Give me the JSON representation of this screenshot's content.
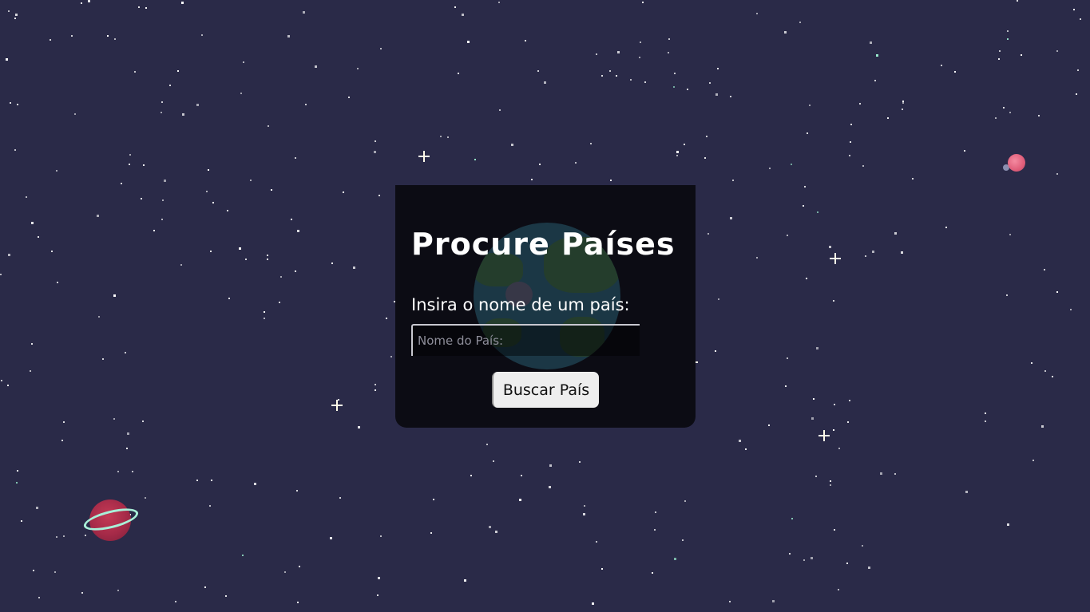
{
  "colors": {
    "background": "#2a2a48",
    "card_background": "#0c0c14",
    "text": "#ffffff",
    "button_background": "#eeeeee",
    "button_text": "#111111",
    "placeholder": "#8e8e9a"
  },
  "card": {
    "title": "Procure Países",
    "field_label": "Insira o nome de um país:",
    "input_value": "",
    "input_placeholder": "Nome do País:",
    "button_label": "Buscar País"
  },
  "decorations": {
    "background_icon": "starfield",
    "card_icon": "earth-planet",
    "planet_icons": [
      "pink-planet-with-moon",
      "red-ringed-planet"
    ]
  }
}
